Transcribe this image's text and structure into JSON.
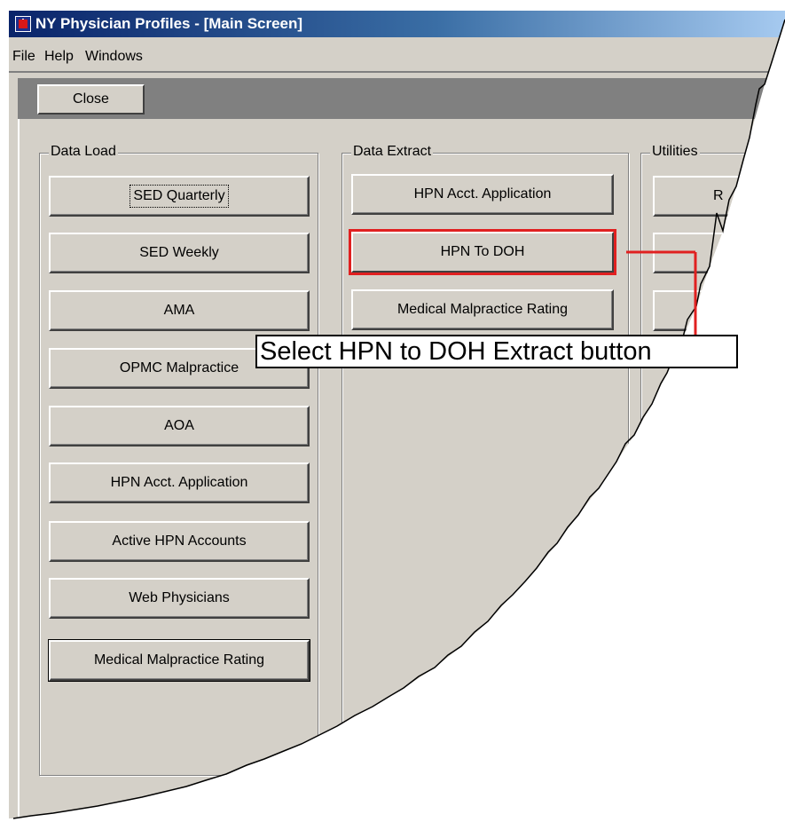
{
  "window": {
    "title": "NY Physician Profiles - [Main Screen]"
  },
  "menubar": {
    "items": [
      "File",
      "Help",
      "Windows"
    ]
  },
  "toolbar": {
    "close_label": "Close"
  },
  "groups": {
    "data_load": {
      "label": "Data Load",
      "buttons": [
        "SED Quarterly",
        "SED Weekly",
        "AMA",
        "OPMC Malpractice",
        "AOA",
        "HPN Acct. Application",
        "Active HPN Accounts",
        "Web Physicians",
        "Medical Malpractice Rating"
      ]
    },
    "data_extract": {
      "label": "Data Extract",
      "buttons": [
        "HPN Acct. Application",
        "HPN To DOH",
        "Medical Malpractice Rating"
      ]
    },
    "utilities": {
      "label": "Utilities",
      "buttons": [
        "R",
        "",
        ""
      ]
    }
  },
  "annotation": {
    "callout_text": "Select HPN to DOH Extract button",
    "highlight_color": "#e02020"
  }
}
